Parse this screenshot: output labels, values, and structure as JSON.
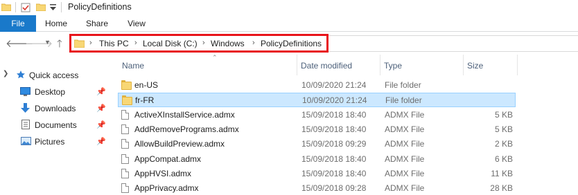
{
  "window": {
    "title": "PolicyDefinitions"
  },
  "ribbon": {
    "tabs": [
      "File",
      "Home",
      "Share",
      "View"
    ]
  },
  "address": {
    "breadcrumbs": [
      "This PC",
      "Local Disk (C:)",
      "Windows",
      "PolicyDefinitions"
    ],
    "highlight_color": "#e8141a"
  },
  "nav_pane": {
    "items": [
      {
        "label": "Quick access",
        "icon": "star-icon"
      },
      {
        "label": "Desktop",
        "icon": "desktop-icon",
        "pinned": true
      },
      {
        "label": "Downloads",
        "icon": "download-arrow-icon",
        "pinned": true
      },
      {
        "label": "Documents",
        "icon": "documents-icon",
        "pinned": true
      },
      {
        "label": "Pictures",
        "icon": "pictures-icon",
        "pinned": true
      }
    ]
  },
  "file_list": {
    "columns": [
      "Name",
      "Date modified",
      "Type",
      "Size"
    ],
    "rows": [
      {
        "name": "en-US",
        "date": "10/09/2020 21:24",
        "type": "File folder",
        "size": "",
        "kind": "folder",
        "selected": false
      },
      {
        "name": "fr-FR",
        "date": "10/09/2020 21:24",
        "type": "File folder",
        "size": "",
        "kind": "folder",
        "selected": true
      },
      {
        "name": "ActiveXInstallService.admx",
        "date": "15/09/2018 18:40",
        "type": "ADMX File",
        "size": "5 KB",
        "kind": "file",
        "selected": false
      },
      {
        "name": "AddRemovePrograms.admx",
        "date": "15/09/2018 18:40",
        "type": "ADMX File",
        "size": "5 KB",
        "kind": "file",
        "selected": false
      },
      {
        "name": "AllowBuildPreview.admx",
        "date": "15/09/2018 09:29",
        "type": "ADMX File",
        "size": "2 KB",
        "kind": "file",
        "selected": false
      },
      {
        "name": "AppCompat.admx",
        "date": "15/09/2018 18:40",
        "type": "ADMX File",
        "size": "6 KB",
        "kind": "file",
        "selected": false
      },
      {
        "name": "AppHVSI.admx",
        "date": "15/09/2018 18:40",
        "type": "ADMX File",
        "size": "11 KB",
        "kind": "file",
        "selected": false
      },
      {
        "name": "AppPrivacy.admx",
        "date": "15/09/2018 09:28",
        "type": "ADMX File",
        "size": "28 KB",
        "kind": "file",
        "selected": false
      }
    ]
  },
  "colors": {
    "file_tab": "#1979ca",
    "selection_bg": "#cce8ff",
    "selection_border": "#99d1ff",
    "folder": "#f8d775"
  }
}
